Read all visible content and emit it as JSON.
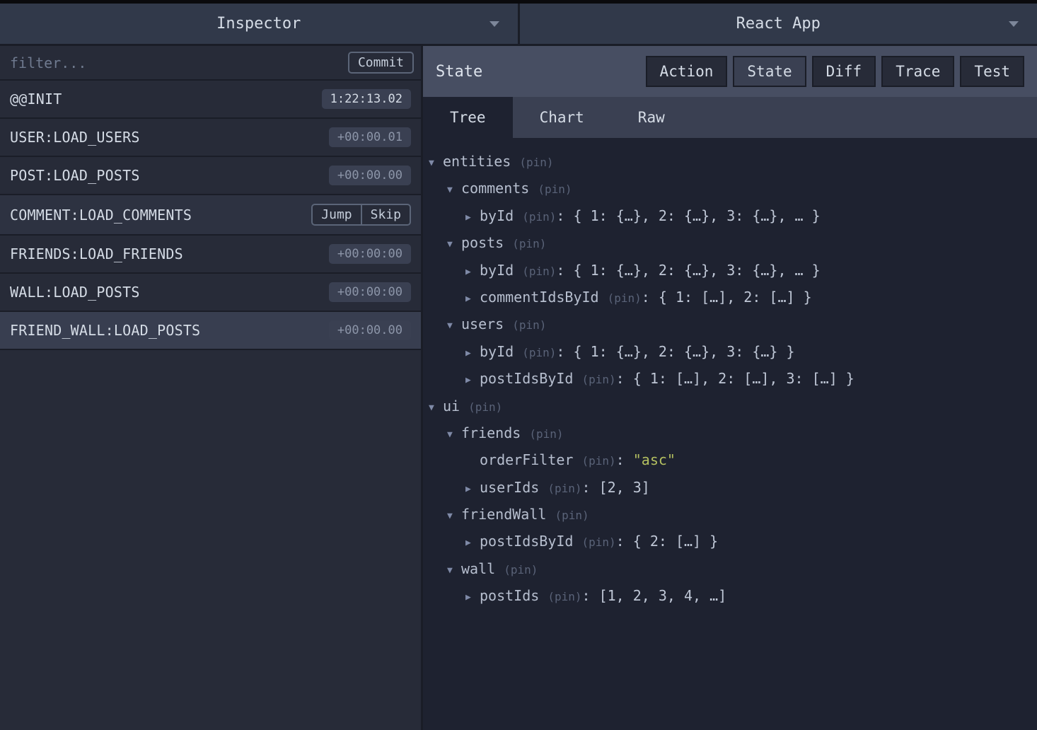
{
  "selectors": {
    "left": "Inspector",
    "right": "React App"
  },
  "filter": {
    "placeholder": "filter...",
    "commit_label": "Commit"
  },
  "actions": [
    {
      "name": "@@INIT",
      "time": "1:22:13.02",
      "bright": true,
      "selected": false,
      "hovered": false,
      "show_buttons": false
    },
    {
      "name": "USER:LOAD_USERS",
      "time": "+00:00.01",
      "bright": false,
      "selected": false,
      "hovered": false,
      "show_buttons": false
    },
    {
      "name": "POST:LOAD_POSTS",
      "time": "+00:00.00",
      "bright": false,
      "selected": false,
      "hovered": false,
      "show_buttons": false
    },
    {
      "name": "COMMENT:LOAD_COMMENTS",
      "time": "",
      "bright": false,
      "selected": false,
      "hovered": true,
      "show_buttons": true
    },
    {
      "name": "FRIENDS:LOAD_FRIENDS",
      "time": "+00:00:00",
      "bright": false,
      "selected": false,
      "hovered": false,
      "show_buttons": false
    },
    {
      "name": "WALL:LOAD_POSTS",
      "time": "+00:00:00",
      "bright": false,
      "selected": false,
      "hovered": false,
      "show_buttons": false
    },
    {
      "name": "FRIEND_WALL:LOAD_POSTS",
      "time": "+00:00.00",
      "bright": false,
      "selected": true,
      "hovered": false,
      "show_buttons": false
    }
  ],
  "action_buttons": {
    "jump": "Jump",
    "skip": "Skip"
  },
  "right_header": {
    "title": "State",
    "tabs": [
      {
        "label": "Action",
        "active": false
      },
      {
        "label": "State",
        "active": true
      },
      {
        "label": "Diff",
        "active": false
      },
      {
        "label": "Trace",
        "active": false
      },
      {
        "label": "Test",
        "active": false
      }
    ]
  },
  "view_tabs": [
    {
      "label": "Tree",
      "active": true
    },
    {
      "label": "Chart",
      "active": false
    },
    {
      "label": "Raw",
      "active": false
    }
  ],
  "pin_label": "(pin)",
  "tree": [
    {
      "indent": 0,
      "arrow": "down",
      "key": "entities",
      "value": null
    },
    {
      "indent": 1,
      "arrow": "down",
      "key": "comments",
      "value": null
    },
    {
      "indent": 2,
      "arrow": "right",
      "key": "byId",
      "value": "{ 1: {…}, 2: {…}, 3: {…}, … }"
    },
    {
      "indent": 1,
      "arrow": "down",
      "key": "posts",
      "value": null
    },
    {
      "indent": 2,
      "arrow": "right",
      "key": "byId",
      "value": "{ 1: {…}, 2: {…}, 3: {…}, … }"
    },
    {
      "indent": 2,
      "arrow": "right",
      "key": "commentIdsById",
      "value": "{ 1: […], 2: […] }"
    },
    {
      "indent": 1,
      "arrow": "down",
      "key": "users",
      "value": null
    },
    {
      "indent": 2,
      "arrow": "right",
      "key": "byId",
      "value": "{ 1: {…}, 2: {…}, 3: {…} }"
    },
    {
      "indent": 2,
      "arrow": "right",
      "key": "postIdsById",
      "value": "{ 1: […], 2: […], 3: […] }"
    },
    {
      "indent": 0,
      "arrow": "down",
      "key": "ui",
      "value": null
    },
    {
      "indent": 1,
      "arrow": "down",
      "key": "friends",
      "value": null
    },
    {
      "indent": 2,
      "arrow": "none",
      "key": "orderFilter",
      "value": "\"asc\"",
      "string": true
    },
    {
      "indent": 2,
      "arrow": "right",
      "key": "userIds",
      "value": "[2, 3]"
    },
    {
      "indent": 1,
      "arrow": "down",
      "key": "friendWall",
      "value": null
    },
    {
      "indent": 2,
      "arrow": "right",
      "key": "postIdsById",
      "value": "{ 2: […] }"
    },
    {
      "indent": 1,
      "arrow": "down",
      "key": "wall",
      "value": null
    },
    {
      "indent": 2,
      "arrow": "right",
      "key": "postIds",
      "value": "[1, 2, 3, 4, …]"
    }
  ]
}
